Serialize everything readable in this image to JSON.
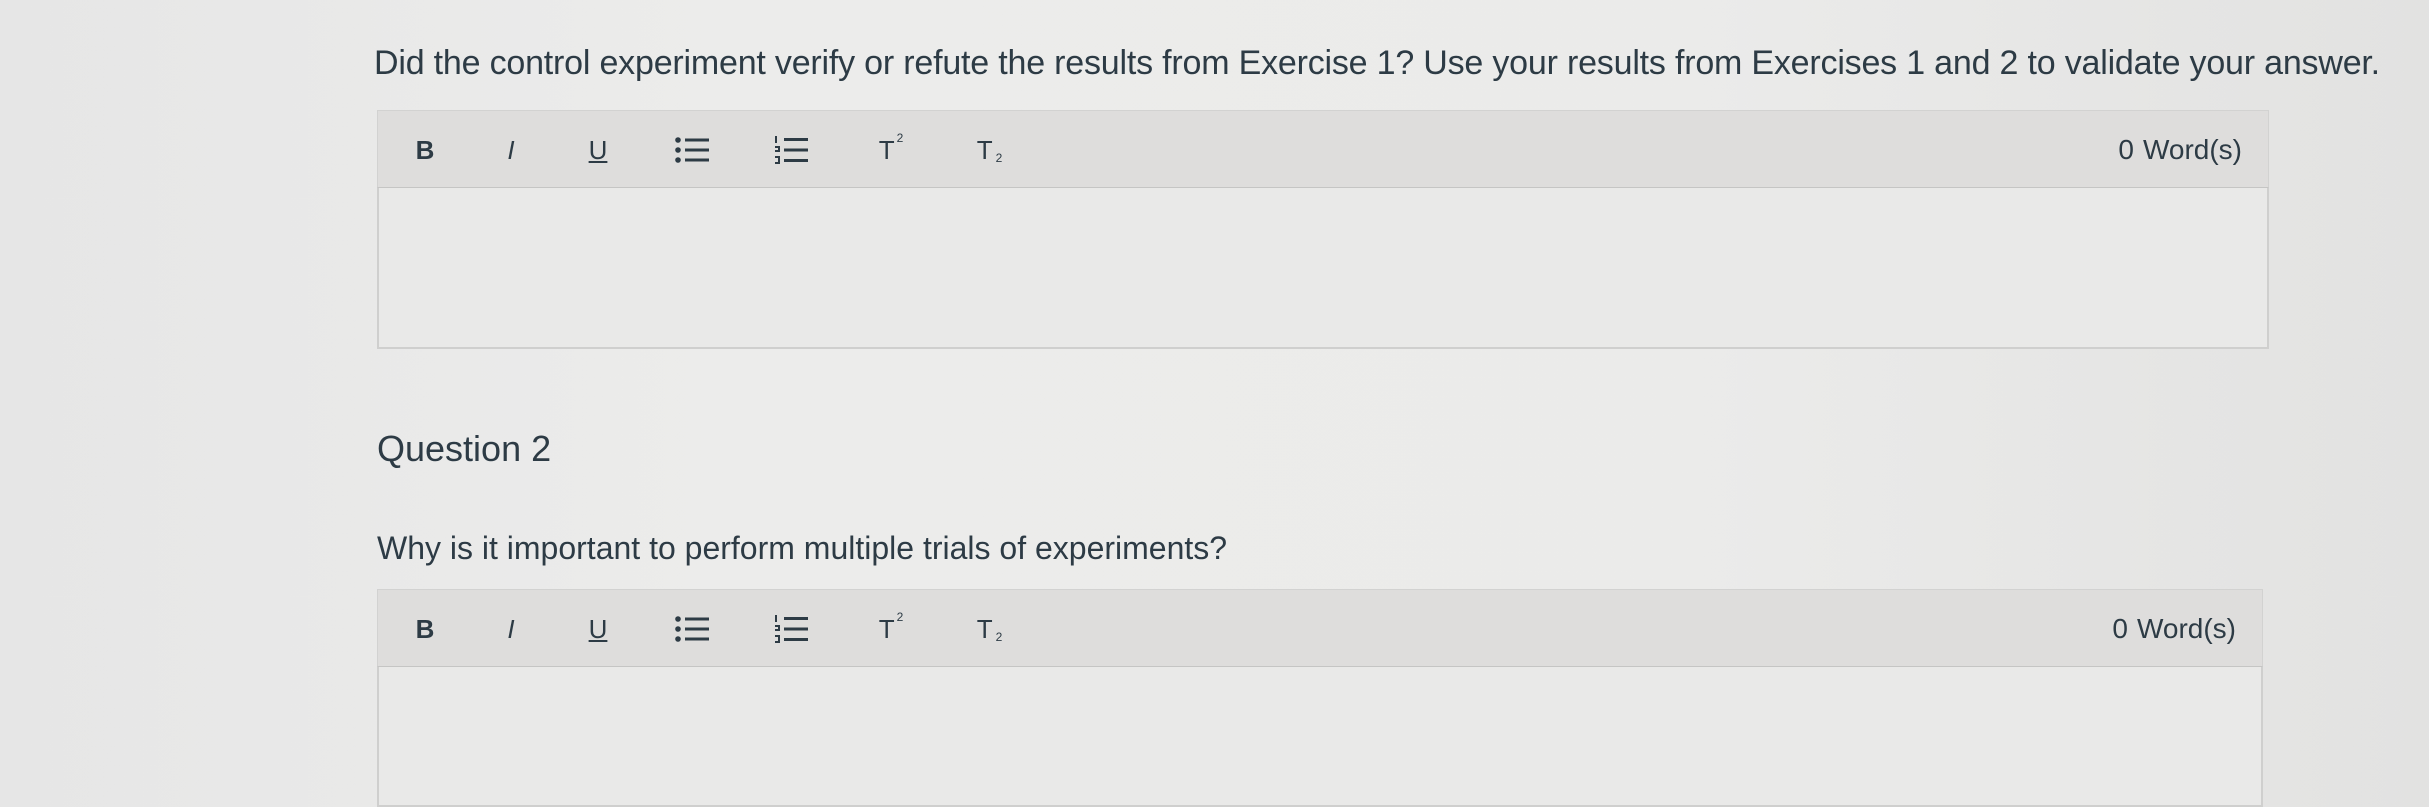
{
  "question1": {
    "prompt": "Did the control experiment verify or refute the results from Exercise 1? Use your results from Exercises 1 and 2 to validate your answer.",
    "editor": {
      "toolbar": {
        "bold": "B",
        "italic": "I",
        "underline": "U",
        "superscript": "T",
        "superscript_mark": "2",
        "subscript": "T",
        "subscript_mark": "2"
      },
      "word_count_value": "0",
      "word_count_label": "Word(s)",
      "text": ""
    }
  },
  "question2": {
    "heading": "Question 2",
    "prompt": "Why is it important to perform multiple trials of experiments?",
    "editor": {
      "toolbar": {
        "bold": "B",
        "italic": "I",
        "underline": "U",
        "superscript": "T",
        "superscript_mark": "2",
        "subscript": "T",
        "subscript_mark": "2"
      },
      "word_count_value": "0",
      "word_count_label": "Word(s)",
      "text": ""
    }
  },
  "icons": {
    "bulleted_list": "bulleted-list-icon",
    "numbered_list": "numbered-list-icon"
  },
  "colors": {
    "text": "#2d3b45",
    "toolbar_bg": "#dedddc",
    "textarea_bg": "#e9e9e8"
  }
}
